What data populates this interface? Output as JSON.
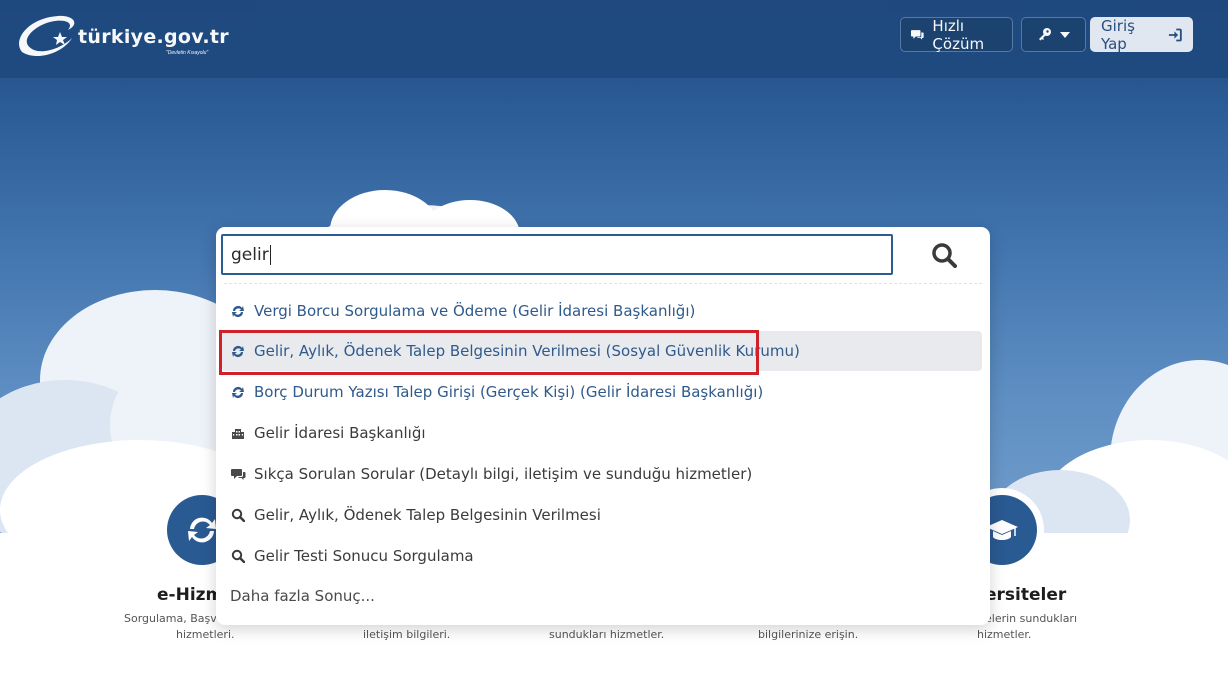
{
  "header": {
    "logo_text": "türkiye.gov.tr",
    "logo_tagline": "\"Devletin Kısayolu\"",
    "quick_solution_label": "Hızlı Çözüm",
    "login_label": "Giriş Yap"
  },
  "search": {
    "query": "gelir",
    "suggestions": [
      {
        "label": "Vergi Borcu Sorgulama ve Ödeme (Gelir İdaresi Başkanlığı)",
        "icon": "e-service-icon"
      },
      {
        "label": "Gelir, Aylık, Ödenek Talep Belgesinin Verilmesi (Sosyal Güvenlik Kurumu)",
        "icon": "e-service-icon"
      },
      {
        "label": "Borç Durum Yazısı Talep Girişi (Gerçek Kişi) (Gelir İdaresi Başkanlığı)",
        "icon": "e-service-icon"
      },
      {
        "label": "Gelir İdaresi Başkanlığı",
        "icon": "institution-icon"
      },
      {
        "label": "Sıkça Sorulan Sorular (Detaylı bilgi, iletişim ve sunduğu hizmetler)",
        "icon": "faq-icon"
      },
      {
        "label": "Gelir, Aylık, Ödenek Talep Belgesinin Verilmesi",
        "icon": "search-icon"
      },
      {
        "label": "Gelir Testi Sonucu Sorgulama",
        "icon": "search-icon"
      }
    ],
    "more_label": "Daha fazla Sonuç..."
  },
  "categories": {
    "left_title": "e-Hizme",
    "left_desc_1": "Sorgulama, Başvuru",
    "left_desc_2": "hizmetleri.",
    "c2_desc": "iletişim bilgileri.",
    "c3_desc": "sundukları hizmetler.",
    "c4_desc": "bilgilerinize erişin.",
    "right_title": "ersiteler",
    "right_desc_1": "elerin sundukları",
    "right_desc_2": "hizmetler."
  },
  "colors": {
    "brand_blue": "#2a5a92",
    "link_blue": "#2f5a8c",
    "highlight_red": "#d0202a"
  }
}
